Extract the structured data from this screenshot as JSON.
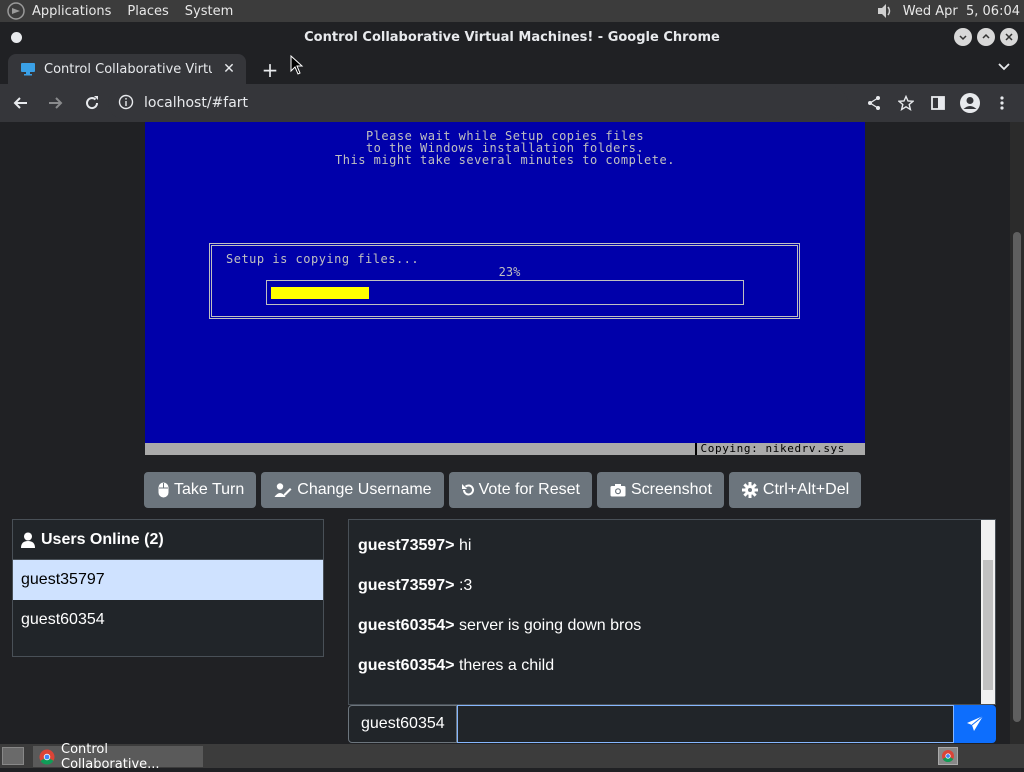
{
  "system_panel": {
    "menus": [
      "Applications",
      "Places",
      "System"
    ],
    "clock": "Wed Apr  5, 06:04"
  },
  "window": {
    "title": "Control Collaborative Virtual Machines! - Google Chrome"
  },
  "tab": {
    "label": "Control Collaborative Virtual Machines!"
  },
  "address_bar": {
    "url": "localhost/#fart"
  },
  "vm_screen": {
    "message_lines": [
      "Please wait while Setup copies files",
      "to the Windows installation folders.",
      "This might take several minutes to complete."
    ],
    "box_label": "Setup is copying files...",
    "percent_label": "23%",
    "progress": 0.21,
    "status_text": "Copying: nikedrv.sys",
    "colors": {
      "background": "#0000aa",
      "progress_fill": "#ffff00",
      "text": "#c0c0c0"
    }
  },
  "controls": {
    "take_turn": "Take Turn",
    "change_username": "Change Username",
    "vote_reset": "Vote for Reset",
    "screenshot": "Screenshot",
    "ctrl_alt_del": "Ctrl+Alt+Del"
  },
  "users_panel": {
    "header": "Users Online (2)",
    "users": [
      "guest35797",
      "guest60354"
    ],
    "selected_user": "guest35797"
  },
  "chat": {
    "messages": [
      {
        "user": "guest73597>",
        "text": " hi"
      },
      {
        "user": "guest73597>",
        "text": " :3"
      },
      {
        "user": "guest60354>",
        "text": " server is going down bros"
      },
      {
        "user": "guest60354>",
        "text": " theres a child"
      }
    ],
    "username": "guest60354",
    "input_value": ""
  },
  "taskbar": {
    "window_label": "Control Collaborative..."
  }
}
